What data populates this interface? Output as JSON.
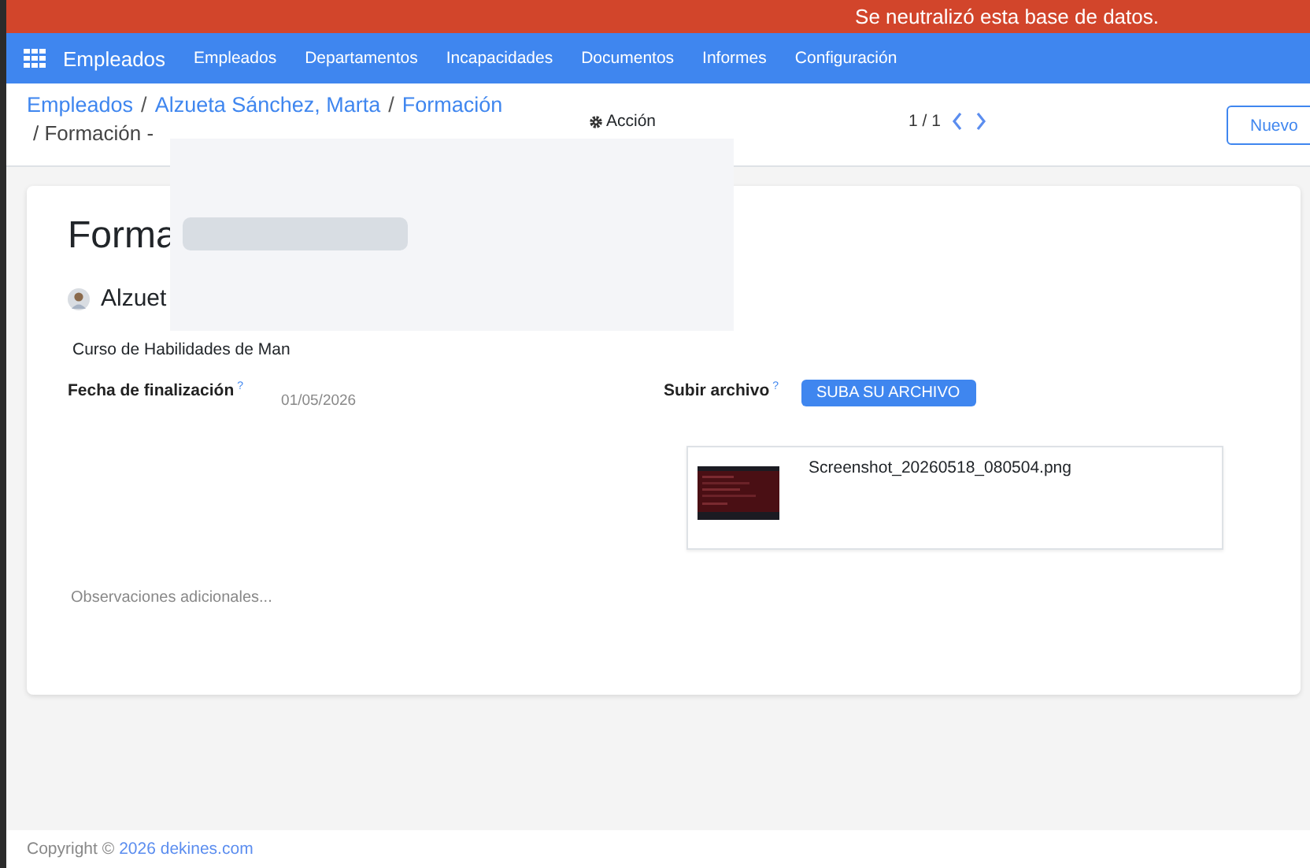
{
  "banner": {
    "text": "Se neutralizó esta base de datos."
  },
  "navbar": {
    "app_name": "Empleados",
    "menu": [
      "Empleados",
      "Departamentos",
      "Incapacidades",
      "Documentos",
      "Informes",
      "Configuración"
    ]
  },
  "breadcrumb": {
    "links": [
      "Empleados",
      "Alzueta Sánchez, Marta",
      "Formación"
    ],
    "separator": "/",
    "current": "/ Formación -"
  },
  "action_label": "Acción",
  "pager": {
    "text": "1 / 1"
  },
  "new_button": "Nuevo",
  "form": {
    "title": "Forma",
    "employee": "Alzuet",
    "course": "Curso de Habilidades de Man",
    "end_date": {
      "label": "Fecha de finalización",
      "help": "?",
      "value": "01/05/2026"
    },
    "upload": {
      "label": "Subir archivo",
      "help": "?",
      "button": "SUBA SU ARCHIVO"
    },
    "attachment": {
      "name": "Screenshot_20260518_080504.png",
      "kind": "picture"
    },
    "notes": {
      "placeholder": "Observaciones adicionales..."
    }
  },
  "footer": {
    "prefix": "Copyright ©",
    "link": "2026 dekines.com"
  }
}
